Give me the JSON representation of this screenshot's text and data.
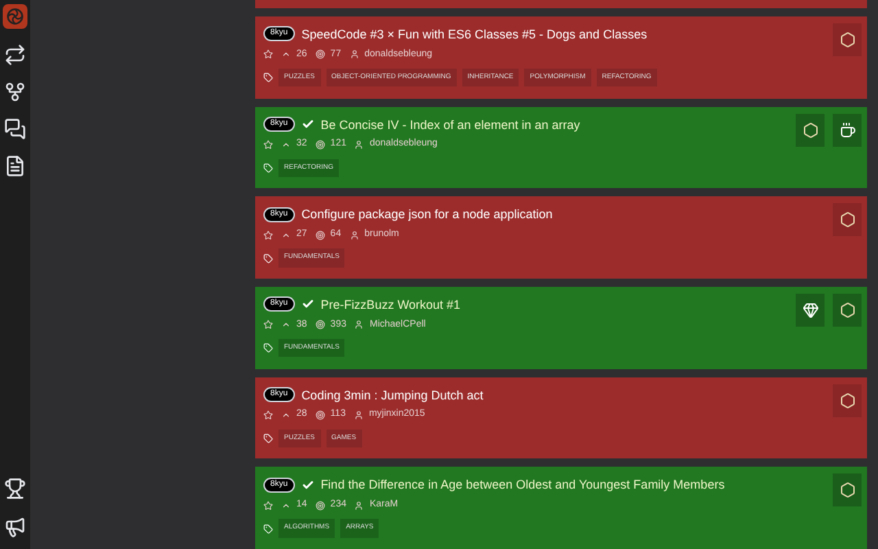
{
  "sidebar": {
    "items": [
      {
        "kind": "logo",
        "selected": true
      },
      {
        "kind": "practice",
        "selected": false
      },
      {
        "kind": "kata",
        "selected": false
      },
      {
        "kind": "discuss",
        "selected": false
      },
      {
        "kind": "docs",
        "selected": false
      }
    ],
    "bottom_items": [
      {
        "kind": "trophy"
      },
      {
        "kind": "announce"
      }
    ]
  },
  "partial_card": {
    "completed": false
  },
  "cards": [
    {
      "completed": false,
      "rank": "8kyu",
      "title": "SpeedCode #3 × Fun with ES6 Classes #5 - Dogs and Classes",
      "upvotes": "26",
      "solved": "77",
      "author": "donaldsebleung",
      "tags": [
        "PUZZLES",
        "OBJECT-ORIENTED PROGRAMMING",
        "INHERITANCE",
        "POLYMORPHISM",
        "REFACTORING"
      ],
      "languages": [
        {
          "kind": "javascript"
        }
      ]
    },
    {
      "completed": true,
      "rank": "8kyu",
      "title": "Be Concise IV - Index of an element in an array",
      "upvotes": "32",
      "solved": "121",
      "author": "donaldsebleung",
      "tags": [
        "REFACTORING"
      ],
      "languages": [
        {
          "kind": "javascript"
        },
        {
          "kind": "coffeescript"
        }
      ]
    },
    {
      "completed": false,
      "rank": "8kyu",
      "title": "Configure package json for a node application",
      "upvotes": "27",
      "solved": "64",
      "author": "brunolm",
      "tags": [
        "FUNDAMENTALS"
      ],
      "languages": [
        {
          "kind": "javascript"
        }
      ]
    },
    {
      "completed": true,
      "rank": "8kyu",
      "title": "Pre-FizzBuzz Workout #1",
      "upvotes": "38",
      "solved": "393",
      "author": "MichaelCPell",
      "tags": [
        "FUNDAMENTALS"
      ],
      "languages": [
        {
          "kind": "crystal"
        },
        {
          "kind": "javascript"
        }
      ]
    },
    {
      "completed": false,
      "rank": "8kyu",
      "title": "Coding 3min : Jumping Dutch act",
      "upvotes": "28",
      "solved": "113",
      "author": "myjinxin2015",
      "tags": [
        "PUZZLES",
        "GAMES"
      ],
      "languages": [
        {
          "kind": "javascript"
        }
      ]
    },
    {
      "completed": true,
      "rank": "8kyu",
      "title": "Find the Difference in Age between Oldest and Youngest Family Members",
      "upvotes": "14",
      "solved": "234",
      "author": "KaraM",
      "tags": [
        "ALGORITHMS",
        "ARRAYS"
      ],
      "languages": [
        {
          "kind": "javascript"
        }
      ]
    }
  ]
}
